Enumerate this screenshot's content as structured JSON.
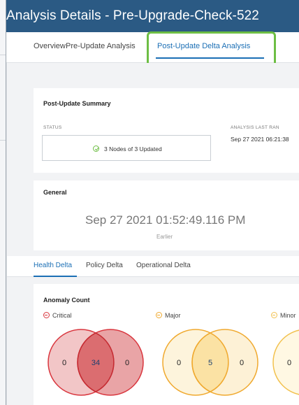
{
  "window": {
    "title": "Analysis Details - Pre-Upgrade-Check-522"
  },
  "tabs": [
    {
      "label": "Overview",
      "active": false
    },
    {
      "label": "Pre-Update Analysis",
      "active": false
    },
    {
      "label": "Post-Update Delta Analysis",
      "active": true
    }
  ],
  "summary": {
    "title": "Post-Update Summary",
    "status_label": "STATUS",
    "status_value": "3 Nodes of 3 Updated",
    "last_ran_label": "ANALYSIS LAST RAN",
    "last_ran_value": "Sep 27 2021 06:21:38"
  },
  "general": {
    "title": "General",
    "date": "Sep 27 2021 01:52:49.116 PM",
    "caption": "Earlier"
  },
  "subtabs": [
    {
      "label": "Health Delta",
      "active": true
    },
    {
      "label": "Policy Delta",
      "active": false
    },
    {
      "label": "Operational Delta",
      "active": false
    }
  ],
  "anomaly": {
    "title": "Anomaly Count",
    "groups": [
      {
        "severity": "Critical",
        "color": "#d9363e",
        "left": "0",
        "both": "34",
        "right": "0"
      },
      {
        "severity": "Major",
        "color": "#f0a92e",
        "left": "0",
        "both": "5",
        "right": "0"
      },
      {
        "severity": "Minor",
        "color": "#f2c14e",
        "left": "0"
      }
    ]
  },
  "colors": {
    "header": "#2b5a84",
    "accent": "#1b6fb5",
    "highlight": "#6dbe44"
  }
}
